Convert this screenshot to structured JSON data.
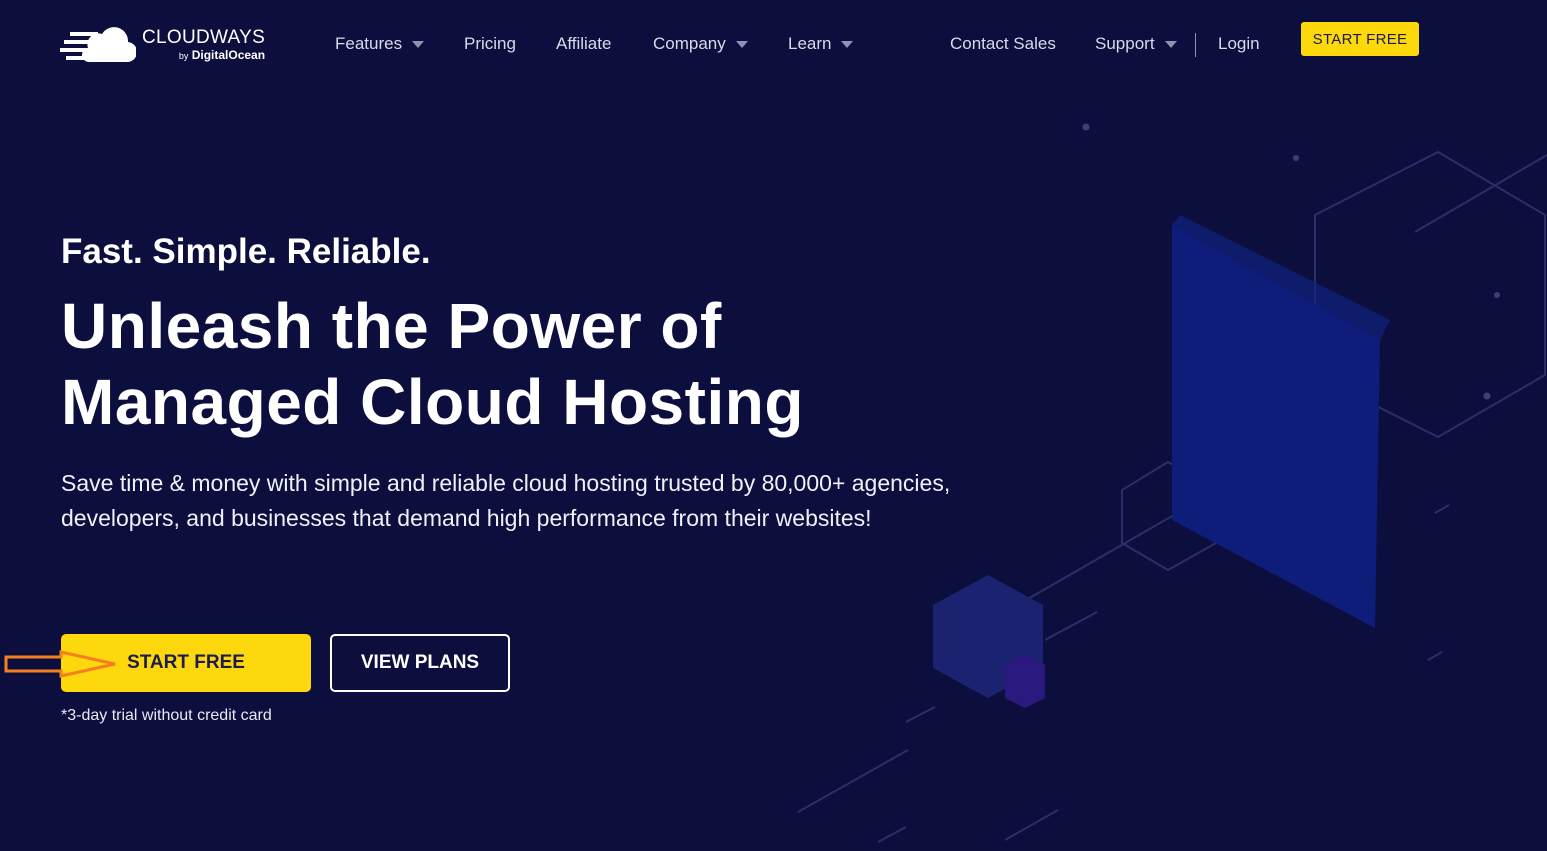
{
  "nav": {
    "logo_main": "CLOUDWAYS",
    "logo_by": "by",
    "logo_sub": "DigitalOcean",
    "items": [
      {
        "label": "Features"
      },
      {
        "label": "Pricing"
      },
      {
        "label": "Affiliate"
      },
      {
        "label": "Company"
      },
      {
        "label": "Learn"
      },
      {
        "label": "Contact Sales"
      },
      {
        "label": "Support"
      },
      {
        "label": "Login"
      }
    ],
    "cta": "START FREE"
  },
  "hero": {
    "tagline": "Fast. Simple. Reliable.",
    "title_line1": "Unleash the Power of",
    "title_line2": "Managed Cloud Hosting",
    "description": "Save time & money with simple and reliable cloud hosting trusted by 80,000+ agencies, developers, and businesses that demand high performance from their websites!",
    "primary_button": "START FREE",
    "secondary_button": "VIEW PLANS",
    "trial_note": "*3-day trial without credit card"
  },
  "colors": {
    "background": "#0c0f3e",
    "accent": "#fdd80c",
    "annotation": "#f57f20"
  }
}
